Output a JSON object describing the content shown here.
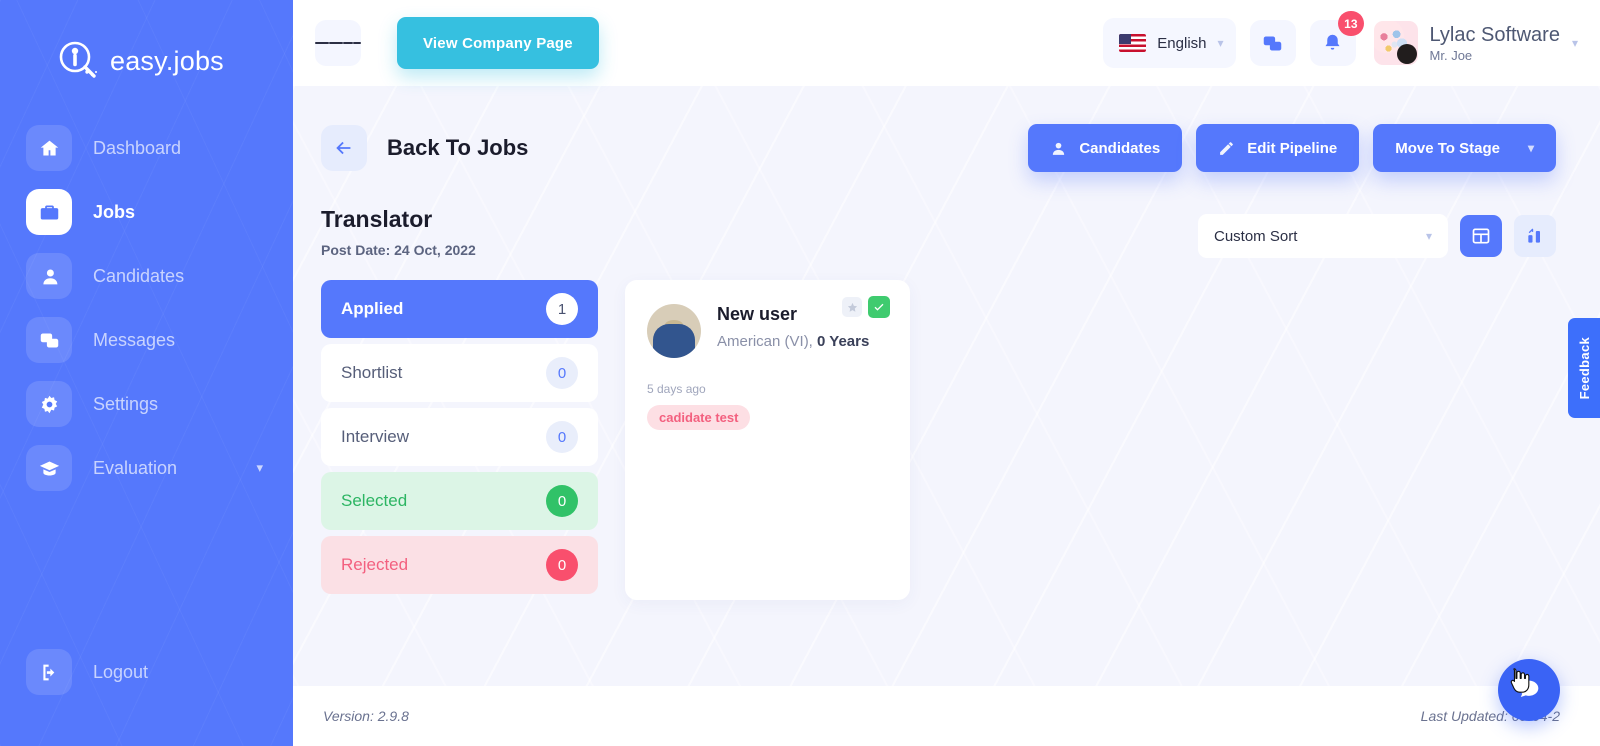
{
  "brand": {
    "name": "easy.jobs",
    "logo_icon": "magnifier-person-icon"
  },
  "sidebar": {
    "items": [
      {
        "label": "Dashboard",
        "icon": "home-icon",
        "active": false
      },
      {
        "label": "Jobs",
        "icon": "briefcase-icon",
        "active": true
      },
      {
        "label": "Candidates",
        "icon": "user-icon",
        "active": false
      },
      {
        "label": "Messages",
        "icon": "chat-icon",
        "active": false
      },
      {
        "label": "Settings",
        "icon": "gear-icon",
        "active": false
      },
      {
        "label": "Evaluation",
        "icon": "graduation-cap-icon",
        "active": false,
        "expandable": true
      }
    ],
    "logout": {
      "label": "Logout",
      "icon": "logout-icon"
    }
  },
  "topbar": {
    "menu_icon": "hamburger-icon",
    "company_button": "View Company Page",
    "language": {
      "label": "English",
      "flag": "us-flag-icon"
    },
    "messages_icon": "chat-bubbles-icon",
    "notifications_icon": "bell-icon",
    "notification_count": "13",
    "profile": {
      "company": "Lylac Software",
      "user": "Mr. Joe"
    }
  },
  "header": {
    "back_label": "Back To Jobs",
    "back_icon": "arrow-left-icon",
    "actions": [
      {
        "label": "Candidates",
        "icon": "user-icon"
      },
      {
        "label": "Edit Pipeline",
        "icon": "pencil-icon"
      },
      {
        "label": "Move To Stage",
        "icon": "chevron-down-icon",
        "has_chevron": true
      }
    ]
  },
  "job": {
    "title": "Translator",
    "post_date": "Post Date: 24 Oct, 2022",
    "sort": {
      "value": "Custom Sort"
    },
    "views": [
      {
        "icon": "grid-view-icon",
        "active": true
      },
      {
        "icon": "chart-view-icon",
        "active": false
      }
    ]
  },
  "pipeline": {
    "stages": [
      {
        "label": "Applied",
        "count": "1",
        "style": "applied"
      },
      {
        "label": "Shortlist",
        "count": "0",
        "style": "default"
      },
      {
        "label": "Interview",
        "count": "0",
        "style": "default"
      },
      {
        "label": "Selected",
        "count": "0",
        "style": "selected"
      },
      {
        "label": "Rejected",
        "count": "0",
        "style": "rejected"
      }
    ]
  },
  "candidate": {
    "name": "New user",
    "meta_prefix": "American (VI), ",
    "meta_experience": "0 Years",
    "time": "5 days ago",
    "tag": "cadidate test",
    "star_icon": "star-icon",
    "check_icon": "check-icon"
  },
  "feedback": {
    "label": "Feedback"
  },
  "footer": {
    "version": "Version: 2.9.8",
    "last_updated": "Last Updated: 09-04-2"
  },
  "fab": {
    "icon": "chat-bubble-icon"
  }
}
